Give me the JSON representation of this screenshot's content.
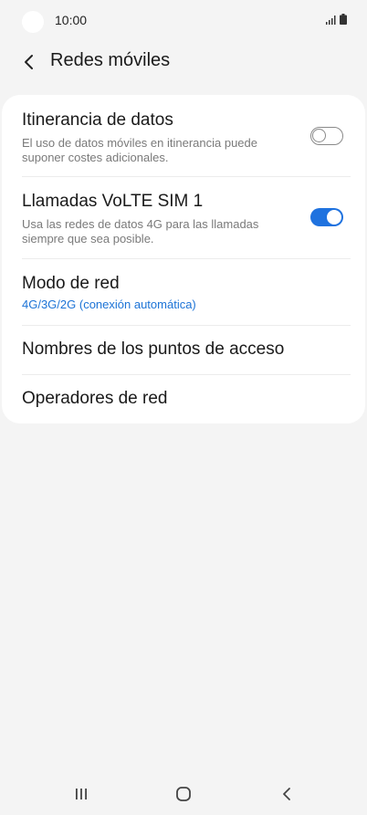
{
  "status_bar": {
    "time": "10:00"
  },
  "header": {
    "title": "Redes móviles"
  },
  "settings": {
    "roaming": {
      "title": "Itinerancia de datos",
      "subtitle": "El uso de datos móviles en itinerancia puede suponer costes adicionales.",
      "enabled": false
    },
    "volte": {
      "title": "Llamadas VoLTE SIM 1",
      "subtitle": "Usa las redes de datos 4G para las llamadas siempre que sea posible.",
      "enabled": true
    },
    "network_mode": {
      "title": "Modo de red",
      "value": "4G/3G/2G (conexión automática)"
    },
    "apn": {
      "title": "Nombres de los puntos de acceso"
    },
    "operators": {
      "title": "Operadores de red"
    }
  },
  "icons": {
    "back": "chevron-left-icon",
    "signal": "signal-icon",
    "battery": "battery-icon",
    "recents": "recent-apps-icon",
    "home": "home-icon",
    "nav_back": "back-icon"
  },
  "colors": {
    "accent": "#1f72df",
    "link": "#1c73d6",
    "background": "#f4f4f4",
    "card": "#ffffff"
  }
}
